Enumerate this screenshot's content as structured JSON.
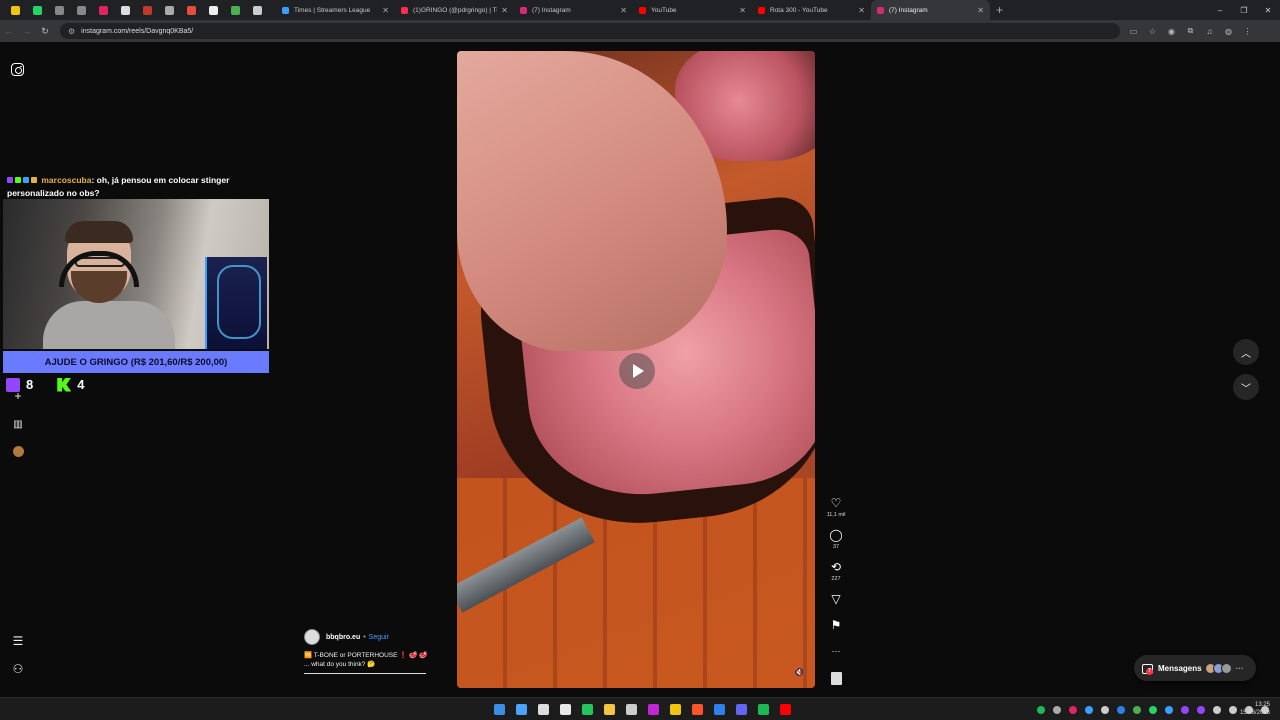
{
  "browser": {
    "tabs": [
      {
        "title": "Times | Streamers League",
        "color": "#3aa0ff",
        "active": false
      },
      {
        "title": "(1)GRINGO (@pdrgringo) | TikTok",
        "color": "#fe2c55",
        "active": false
      },
      {
        "title": "(7) Instagram",
        "color": "#d62976",
        "active": false
      },
      {
        "title": "YouTube",
        "color": "#ff0000",
        "active": false
      },
      {
        "title": "Rota 300 - YouTube",
        "color": "#ff0000",
        "active": false
      },
      {
        "title": "(7) Instagram",
        "color": "#d62976",
        "active": true
      }
    ],
    "pinned_tab_colors": [
      "#f1c40f",
      "#25d366",
      "#888888",
      "#888888",
      "#e0245e",
      "#dddddd",
      "#c0392b",
      "#aaaaaa",
      "#e74c3c",
      "#eeeeee",
      "#4caf50",
      "#cccccc"
    ],
    "new_tab_symbol": "+",
    "window_controls": {
      "minimize": "–",
      "restore": "❐",
      "close": "✕"
    },
    "address": "instagram.com/reels/Davgnq0KBa5/"
  },
  "stream_overlay": {
    "chat_user": "marcoscuba",
    "chat_message": ": oh, já pensou em colocar stinger personalizado no obs?",
    "badge_colors": [
      "#9146ff",
      "#53fc18",
      "#3aa0ff",
      "#e3b341"
    ],
    "donation_goal": "AJUDE O GRINGO (R$ 201,60/R$ 200,00)",
    "twitch_count": "8",
    "kick_count": "4"
  },
  "sidebar": {
    "create_icon": "+",
    "insights_icon": "▥",
    "more_icon": "☰",
    "threads_icon": "⚇"
  },
  "reel": {
    "author": "bbqbro.eu",
    "separator": "•",
    "follow_label": "Seguir",
    "caption_line1": "🆚 T-BONE or PORTERHOUSE ❗ 🥩 🥩",
    "caption_line2": "... what do you think? 🤔",
    "mute_icon": "🔇",
    "actions": {
      "like_icon": "♡",
      "likes": "11,1 mil",
      "comment_icon": "◯",
      "comments": "37",
      "repost_icon": "⟲",
      "reposts": "227",
      "share_icon": "▽",
      "save_icon": "⚑",
      "more_icon": "···"
    }
  },
  "navigation": {
    "prev_icon": "︿",
    "next_icon": "﹀"
  },
  "messages": {
    "label": "Mensagens",
    "unread": "7",
    "avatar_colors": [
      "#c9a27e",
      "#8aa0d8",
      "#9a9a9a"
    ]
  },
  "taskbar": {
    "app_colors": [
      "#3a8ee6",
      "#4aa3ff",
      "#dddddd",
      "#e8e8e8",
      "#22c55e",
      "#f4c542",
      "#cccccc",
      "#c026d3",
      "#f1c40f",
      "#fb542b",
      "#2f80ed",
      "#6366f1",
      "#1db954",
      "#ff0000"
    ],
    "tray_colors": [
      "#1db954",
      "#aaaaaa",
      "#e0245e",
      "#3aa0ff",
      "#cccccc",
      "#2f80ed",
      "#4caf50",
      "#25d366",
      "#3aa0ff",
      "#9146ff",
      "#9146ff",
      "#cccccc",
      "#cccccc",
      "#cccccc",
      "#cccccc"
    ],
    "time": "13:25",
    "date": "15/08/2026"
  }
}
